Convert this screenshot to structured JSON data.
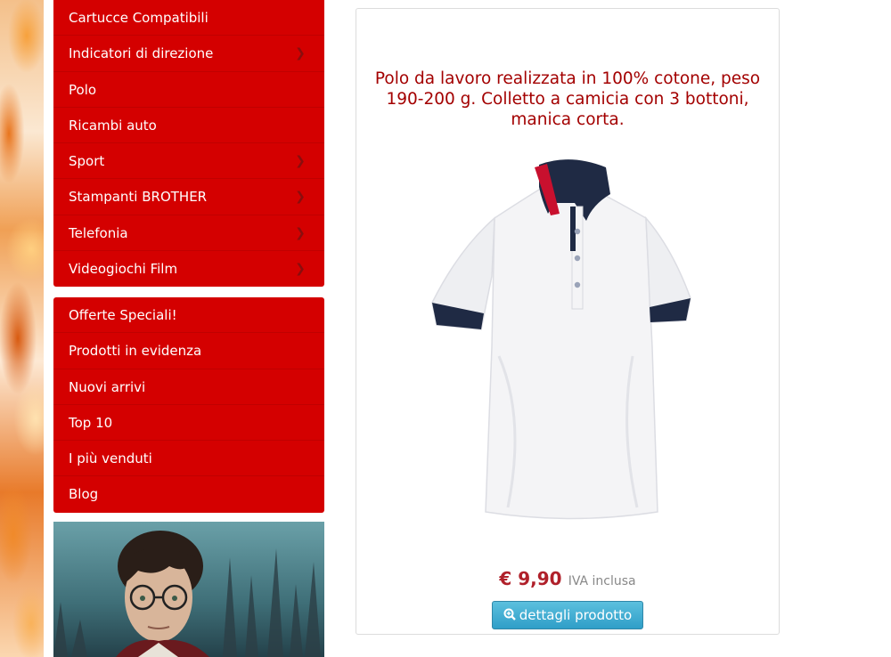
{
  "sidebar": {
    "categories": [
      {
        "label": "Cartucce Compatibili",
        "has_children": false
      },
      {
        "label": "Indicatori di direzione",
        "has_children": true
      },
      {
        "label": "Polo",
        "has_children": false
      },
      {
        "label": "Ricambi auto",
        "has_children": false
      },
      {
        "label": "Sport",
        "has_children": true
      },
      {
        "label": "Stampanti BROTHER",
        "has_children": true
      },
      {
        "label": "Telefonia",
        "has_children": true
      },
      {
        "label": "Videogiochi Film",
        "has_children": true
      }
    ],
    "links": [
      {
        "label": "Offerte Speciali!"
      },
      {
        "label": "Prodotti in evidenza"
      },
      {
        "label": "Nuovi arrivi"
      },
      {
        "label": "Top 10"
      },
      {
        "label": "I più venduti"
      },
      {
        "label": "Blog"
      }
    ],
    "chevron_icon": "chevron-right-icon",
    "colors": {
      "menu_bg": "#d40000",
      "menu_text": "#ffffff"
    }
  },
  "product": {
    "description": "Polo da lavoro realizzata in 100% cotone, peso 190-200 g. Colletto a camicia con 3 bottoni, manica corta.",
    "price": "€ 9,90",
    "vat_note": "IVA inclusa",
    "details_button": "dettagli prodotto",
    "details_icon": "zoom-in-icon",
    "colors": {
      "description": "#a30000",
      "price": "#b0202a",
      "button": "#2f9ec8"
    }
  }
}
